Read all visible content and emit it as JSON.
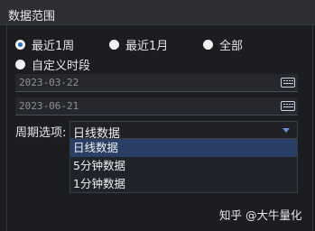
{
  "group": {
    "title": "数据范围"
  },
  "range": {
    "options": [
      {
        "label": "最近1周",
        "checked": true
      },
      {
        "label": "最近1月",
        "checked": false
      },
      {
        "label": "全部",
        "checked": false
      },
      {
        "label": "自定义时段",
        "checked": false
      }
    ]
  },
  "dates": {
    "start": "2023-03-22",
    "end": "2023-06-21",
    "icon": "keyboard-icon"
  },
  "period": {
    "label": "周期选项:",
    "selected": "日线数据",
    "options": [
      "日线数据",
      "5分钟数据",
      "1分钟数据"
    ]
  },
  "watermark": "知乎 @大牛量化",
  "colors": {
    "accent": "#1f6fd1",
    "highlight": "#2b3f66"
  }
}
